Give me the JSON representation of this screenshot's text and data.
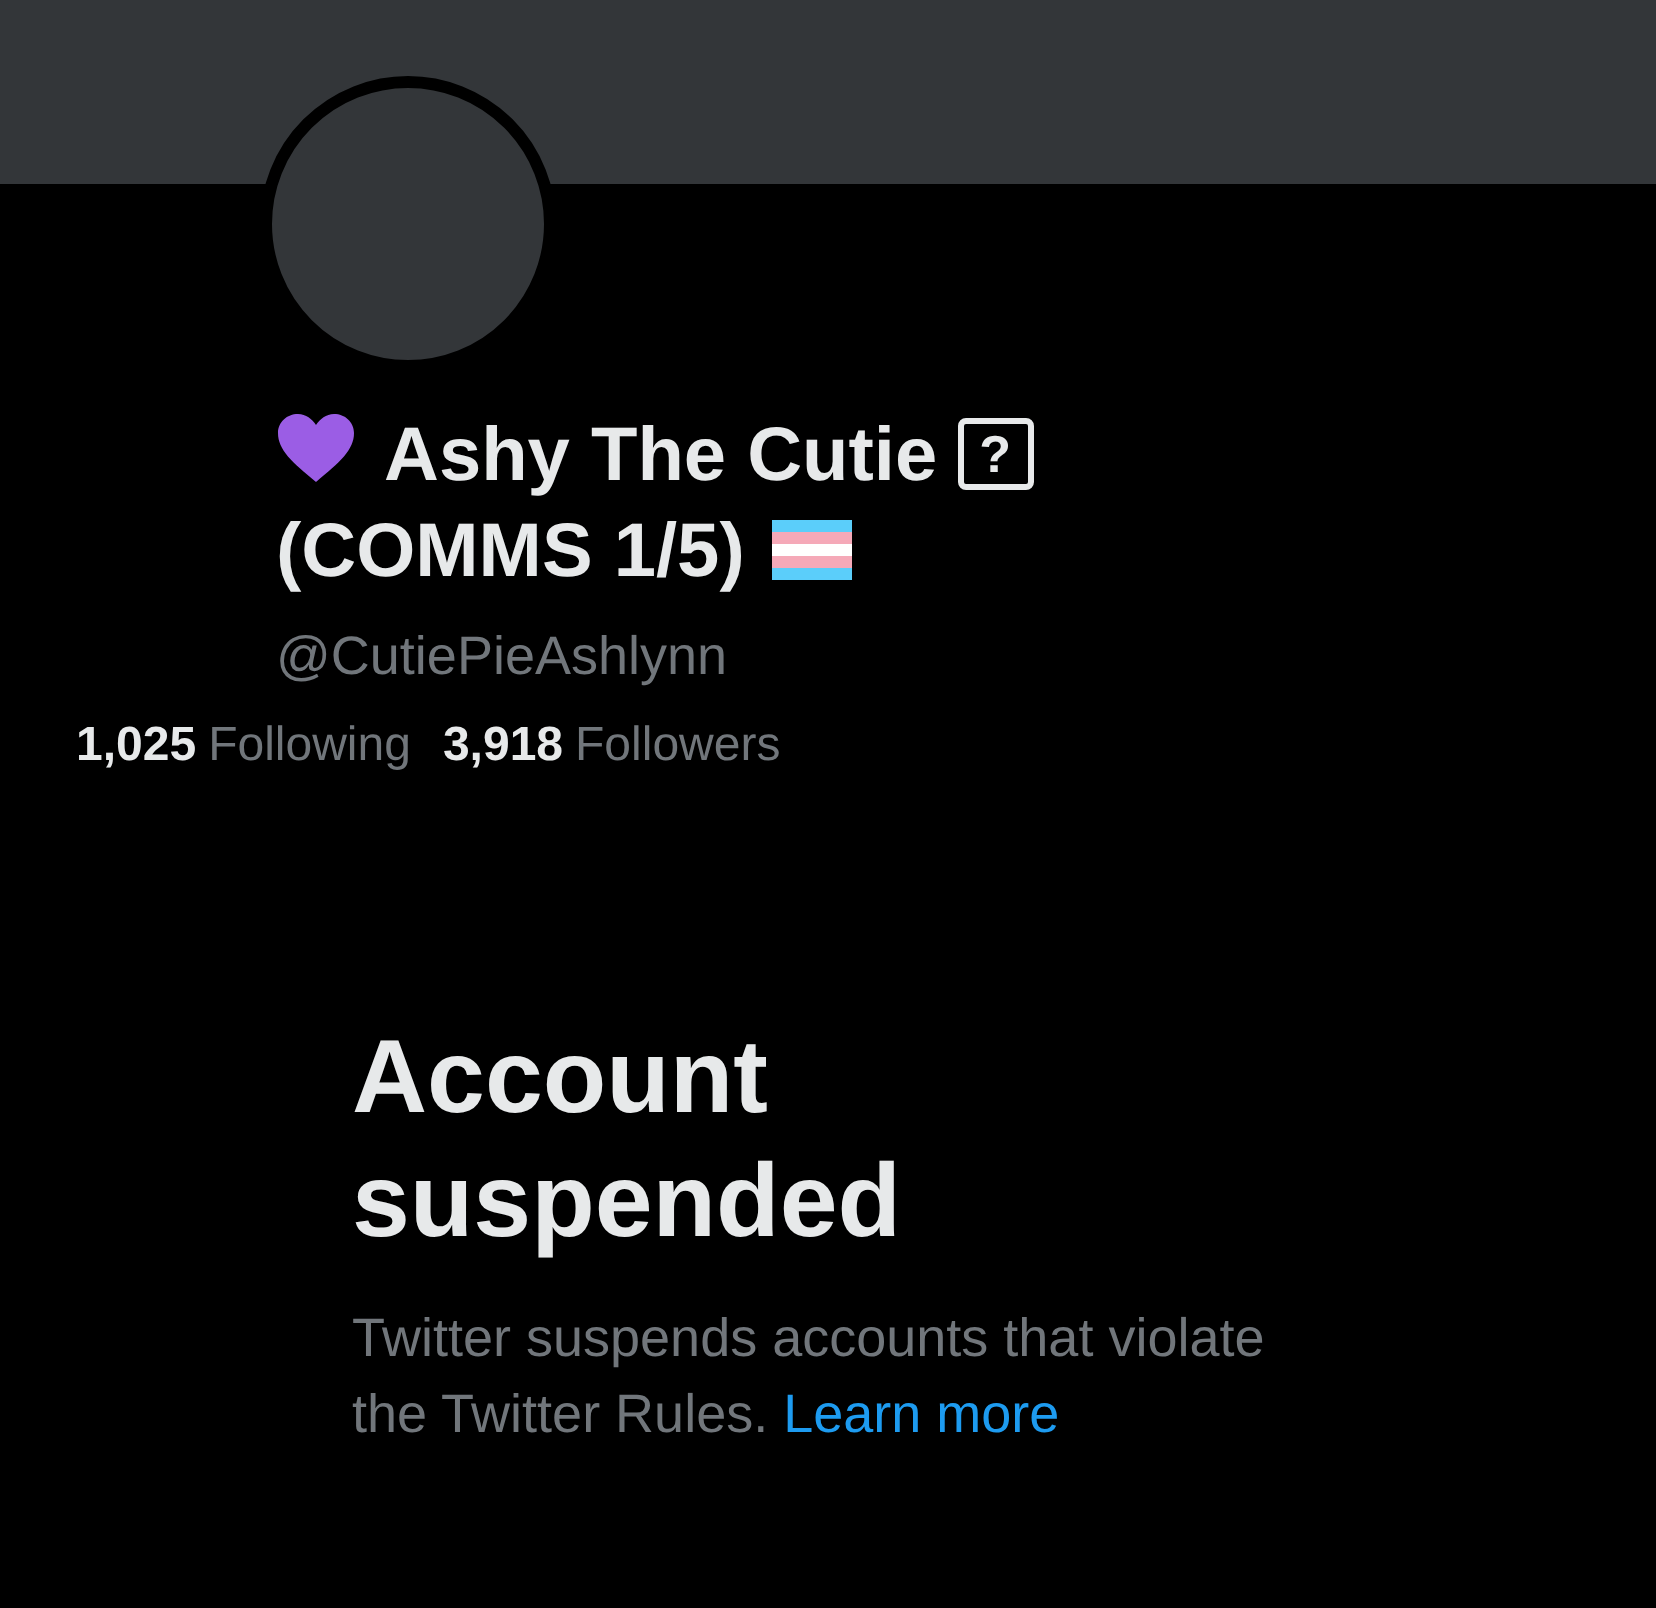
{
  "profile": {
    "display_name": "Ashy The Cutie",
    "missing_glyph": "?",
    "display_name_suffix": "(COMMS 1/5)",
    "handle": "@CutiePieAshlynn",
    "stats": [
      {
        "count": "1,025",
        "label": "Following"
      },
      {
        "count": "3,918",
        "label": "Followers"
      }
    ]
  },
  "notice": {
    "title": "Account suspended",
    "body": "Twitter suspends accounts that violate the Twitter Rules.",
    "link": "Learn more"
  }
}
